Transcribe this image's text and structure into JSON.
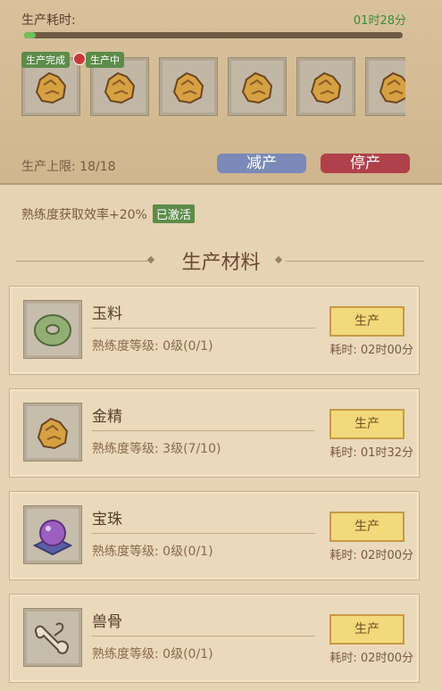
{
  "header": {
    "time_label": "生产耗时:",
    "time_value": "01时28分",
    "progress": 0.03,
    "done_tag": "生产完成",
    "progress_tag": "生产中",
    "slot_icon": "gold-ore-icon",
    "slot_count": 6,
    "limit": "生产上限: 18/18",
    "reduce_label": "减产",
    "stop_label": "停产"
  },
  "efficiency": {
    "text": "熟练度获取效率+20%",
    "status": "已激活"
  },
  "section": {
    "title": "生产材料"
  },
  "materials": [
    {
      "name": "玉料",
      "level": "熟练度等级: 0级(0/1)",
      "button": "生产",
      "time": "耗时: 02时00分",
      "icon": "jade-disc-icon"
    },
    {
      "name": "金精",
      "level": "熟练度等级: 3级(7/10)",
      "button": "生产",
      "time": "耗时: 01时32分",
      "icon": "gold-ore-icon"
    },
    {
      "name": "宝珠",
      "level": "熟练度等级: 0级(0/1)",
      "button": "生产",
      "time": "耗时: 02时00分",
      "icon": "purple-pearl-icon"
    },
    {
      "name": "兽骨",
      "level": "熟练度等级: 0级(0/1)",
      "button": "生产",
      "time": "耗时: 02时00分",
      "icon": "beast-bone-icon"
    }
  ],
  "colors": {
    "accent_green": "#5d8c4a",
    "button_gold": "#f2d97c",
    "reduce_blue": "#7a89b8",
    "stop_red": "#b0414a"
  }
}
